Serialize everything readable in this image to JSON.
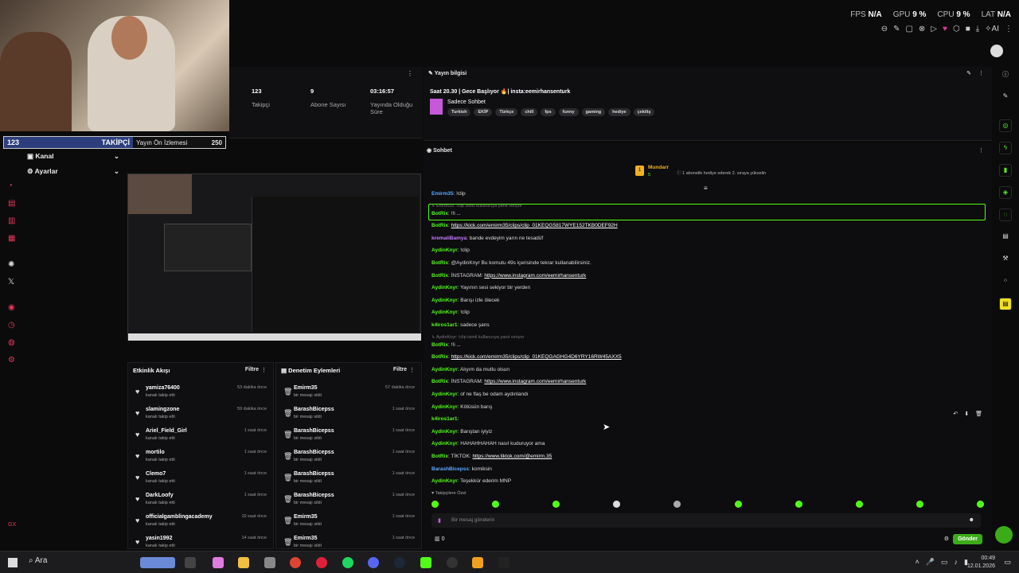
{
  "perf": {
    "fps_label": "FPS",
    "fps": "N/A",
    "gpu_label": "GPU",
    "gpu": "9 %",
    "cpu_label": "CPU",
    "cpu": "9 %",
    "lat_label": "LAT",
    "lat": "N/A",
    "ai": "AI"
  },
  "followbar": {
    "count": "123",
    "label": "TAKİPÇİ",
    "views_label": "Yayın Ön İzlemesi",
    "views": "250"
  },
  "nav": {
    "kanal": "Kanal",
    "ayarlar": "Ayarlar"
  },
  "stats": [
    {
      "value": "123",
      "label": "Takipçi"
    },
    {
      "value": "9",
      "label": "Abone Sayısı"
    },
    {
      "value": "03:16:57",
      "label": "Yayında Olduğu Süre"
    }
  ],
  "stream_info": {
    "header": "Yayın bilgisi",
    "title": "Saat 20.30 | Gece Başlıyor 🔥| insta:eemirhansenturk",
    "category": "Sadece Sohbet",
    "tags": [
      "Turkish",
      "EKİP",
      "Türkçe",
      "chill",
      "fps",
      "funny",
      "gaming",
      "hediye",
      "çekiliş"
    ]
  },
  "chat": {
    "header": "Sohbet",
    "pinned_user": "Mundarr",
    "pinned_badge": "5",
    "pinned_text": "1 abonelik hediye ederek 2. sıraya yükselin",
    "messages": [
      {
        "user": "Emirm35",
        "text": "!clip",
        "cls": "ublue"
      },
      {
        "reply": "Emirm35: !clip isimli kullanıcıya yanıt veriyor",
        "user": "BotRix",
        "text": "!!i ...",
        "cls": "ubot"
      },
      {
        "user": "BotRix",
        "link": "https://kick.com/emirm35/clips/clip_01KEQG5817WYE152TKB0DEF92H",
        "cls": "ubot"
      },
      {
        "user": "kremaliBamya",
        "text": "bande evdeyim yarın ne tesadüf",
        "cls": "upurple"
      },
      {
        "user": "AydinKnyr",
        "text": "!clip",
        "cls": "ugreen"
      },
      {
        "user": "BotRix",
        "text": "@AydinKnyr Bu komutu 49s içerisinde tekrar kullanabilirsiniz.",
        "cls": "ubot"
      },
      {
        "user": "BotRix",
        "text": "İNSTAGRAM:",
        "link": "https://www.instagram.com/eemirhansenturk",
        "cls": "ubot"
      },
      {
        "user": "AydinKnyr",
        "text": "Yayının sesi sekiyor bir yerden",
        "cls": "ugreen"
      },
      {
        "user": "AydinKnyr",
        "text": "Barışı izle ölecek",
        "cls": "ugreen"
      },
      {
        "user": "AydinKnyr",
        "text": "!clip",
        "cls": "ugreen"
      },
      {
        "user": "k4iros1ar1",
        "text": "sadece şans",
        "cls": "ugreen"
      },
      {
        "reply": "AydinKnyr: !clip isimli kullanıcıya yanıt veriyor",
        "user": "BotRix",
        "text": "!!i ...",
        "cls": "ubot"
      },
      {
        "user": "BotRix",
        "link": "https://kick.com/emirm35/clips/clip_01KEQGAGHG4D6YRY16RW45AXX5",
        "cls": "ubot"
      },
      {
        "user": "AydinKnyr",
        "text": "Alıyım da mutlu olsun",
        "cls": "ugreen"
      },
      {
        "user": "BotRix",
        "text": "İNSTAGRAM:",
        "link": "https://www.instagram.com/eemirhansenturk",
        "cls": "ubot"
      },
      {
        "user": "AydinKnyr",
        "text": "of ne flaş be odam aydınlandı",
        "cls": "ugreen"
      },
      {
        "user": "AydinKnyr",
        "text": "Kötüsün barış",
        "cls": "ugreen"
      },
      {
        "user": "k4iros1ar1",
        "text": "",
        "cls": "ugreen"
      },
      {
        "user": "AydinKnyr",
        "text": "Barıştan iyiyiz",
        "cls": "ugreen"
      },
      {
        "user": "AydinKnyr",
        "text": "HAHAHHAHAH nasıl kuduruyor ama",
        "cls": "ugreen"
      },
      {
        "user": "BotRix",
        "text": "TİKTOK:",
        "link": "https://www.tiktok.com/@emirm.35",
        "cls": "ubot"
      },
      {
        "user": "BarashBicepss",
        "text": "komiksin",
        "cls": "ublue"
      },
      {
        "user": "AydinKnyr",
        "text": "Teşekkür ederim MNP",
        "cls": "ugreen"
      }
    ],
    "follower_only": "Takipçilere Özel",
    "input_placeholder": "Bir mesaj gönderin",
    "count": "0",
    "send": "Gönder"
  },
  "activity": {
    "header": "Etkinlik Akışı",
    "filter": "Filtre",
    "rows": [
      {
        "name": "yamiza76400",
        "sub": "kanalı takip etti",
        "time": "53 dakika önce"
      },
      {
        "name": "slamingzone",
        "sub": "kanalı takip etti",
        "time": "59 dakika önce"
      },
      {
        "name": "Ariel_Field_Girl",
        "sub": "kanalı takip etti",
        "time": "1 saat önce"
      },
      {
        "name": "mortilo",
        "sub": "kanalı takip etti",
        "time": "1 saat önce"
      },
      {
        "name": "Clemo7",
        "sub": "kanalı takip etti",
        "time": "1 saat önce"
      },
      {
        "name": "DarkLoofy",
        "sub": "kanalı takip etti",
        "time": "1 saat önce"
      },
      {
        "name": "officialgamblingacademy",
        "sub": "kanalı takip etti",
        "time": "10 saat önce"
      },
      {
        "name": "yasin1992",
        "sub": "kanalı takip etti",
        "time": "14 saat önce"
      }
    ]
  },
  "moderation": {
    "header": "Denetim Eylemleri",
    "filter": "Filtre",
    "rows": [
      {
        "name": "Emirm35",
        "sub": "bir mesajı sildi",
        "time": "57 dakika önce"
      },
      {
        "name": "BarashBicepss",
        "sub": "bir mesajı sildi",
        "time": "1 saat önce"
      },
      {
        "name": "BarashBicepss",
        "sub": "bir mesajı sildi",
        "time": "1 saat önce"
      },
      {
        "name": "BarashBicepss",
        "sub": "bir mesajı sildi",
        "time": "1 saat önce"
      },
      {
        "name": "BarashBicepss",
        "sub": "bir mesajı sildi",
        "time": "1 saat önce"
      },
      {
        "name": "BarashBicepss",
        "sub": "bir mesajı sildi",
        "time": "1 saat önce"
      },
      {
        "name": "Emirm35",
        "sub": "bir mesajı sildi",
        "time": "1 saat önce"
      },
      {
        "name": "Emirm35",
        "sub": "bir mesajı sildi",
        "time": "1 saat önce"
      }
    ]
  },
  "taskbar": {
    "search": "Ara",
    "time": "00:49",
    "date": "12.01.2026"
  }
}
